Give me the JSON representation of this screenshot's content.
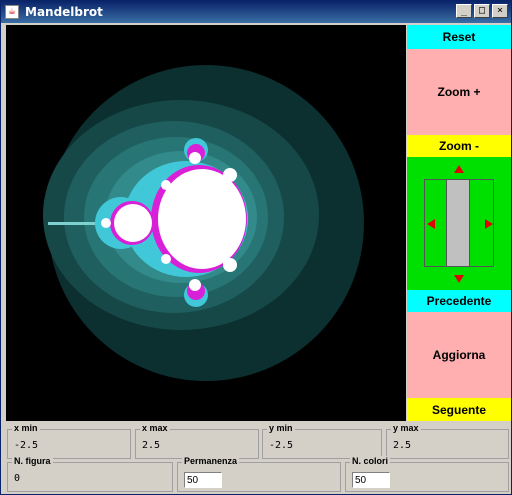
{
  "window": {
    "title": "Mandelbrot",
    "icon": "java-icon"
  },
  "title_buttons": {
    "minimize": "_",
    "maximize": "□",
    "close": "×"
  },
  "buttons": {
    "reset": "Reset",
    "zoom_in": "Zoom +",
    "zoom_out": "Zoom -",
    "previous": "Precedente",
    "refresh": "Aggiorna",
    "next": "Seguente"
  },
  "colors": {
    "reset_bg": "#00ffff",
    "zoom_in_bg": "#ffafaf",
    "zoom_out_bg": "#ffff00",
    "nav_bg": "#00e000",
    "arrow": "#e00000",
    "previous_bg": "#00ffff",
    "refresh_bg": "#ffafaf",
    "next_bg": "#ffff00",
    "canvas_bg": "#000000"
  },
  "fields": {
    "x_min": {
      "label": "x min",
      "value": "-2.5"
    },
    "x_max": {
      "label": "x max",
      "value": "2.5"
    },
    "y_min": {
      "label": "y min",
      "value": "-2.5"
    },
    "y_max": {
      "label": "y max",
      "value": "2.5"
    },
    "n_figura": {
      "label": "N. figura",
      "value": "0"
    },
    "permanenza": {
      "label": "Permanenza",
      "value": "50"
    },
    "n_colori": {
      "label": "N. colori",
      "value": "50"
    }
  }
}
